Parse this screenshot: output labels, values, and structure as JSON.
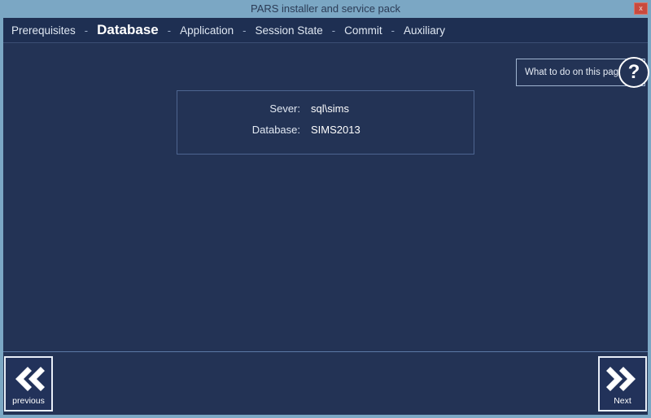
{
  "window": {
    "title": "PARS installer and service pack",
    "close_label": "x",
    "close_icon": "close-icon"
  },
  "nav": {
    "separator": "-",
    "items": [
      {
        "label": "Prerequisites",
        "active": false
      },
      {
        "label": "Database",
        "active": true
      },
      {
        "label": "Application",
        "active": false
      },
      {
        "label": "Session State",
        "active": false
      },
      {
        "label": "Commit",
        "active": false
      },
      {
        "label": "Auxiliary",
        "active": false
      }
    ]
  },
  "help": {
    "label": "What to do on this page",
    "icon": "question-mark-icon",
    "icon_glyph": "?"
  },
  "info_panel": {
    "rows": [
      {
        "label": "Sever:",
        "value": "sql\\sims"
      },
      {
        "label": "Database:",
        "value": "SIMS2013"
      }
    ]
  },
  "footer": {
    "previous": {
      "label": "previous",
      "icon": "double-chevron-left-icon"
    },
    "next": {
      "label": "Next",
      "icon": "double-chevron-right-icon"
    }
  },
  "colors": {
    "titlebar": "#7ba7c4",
    "frame": "#7ba7c4",
    "content_bg": "#233355",
    "nav_bg": "#1e2f52",
    "accent_text": "#ffffff",
    "close_button": "#c94a3e"
  }
}
